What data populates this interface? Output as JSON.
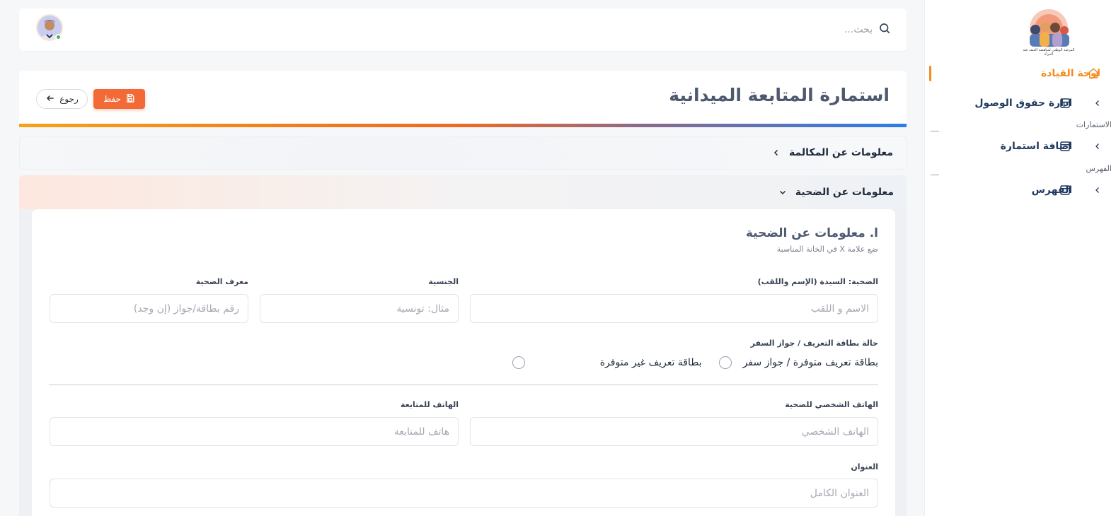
{
  "sidebar": {
    "logo_text": "المرصد الوطني لمناهضة العنف ضد المرأة",
    "items": [
      {
        "label": "لوحة القيادة",
        "icon": "home-icon"
      },
      {
        "label": "ادارة حقوق الوصول",
        "icon": "layout-icon"
      },
      {
        "label": "اضافة استمارة",
        "icon": "form-icon"
      },
      {
        "label": "الفهرس",
        "icon": "form-icon"
      }
    ],
    "sections": [
      "الاستمارات",
      "الفهرس"
    ]
  },
  "topbar": {
    "search_placeholder": "بحث..."
  },
  "header": {
    "title": "استمارة المتابعة الميدانية",
    "save_label": "حفظ",
    "back_label": "رجوع"
  },
  "accordions": [
    {
      "title": "معلومات عن المكالمة",
      "expanded": false
    },
    {
      "title": "معلومات عن الضحية",
      "expanded": true
    }
  ],
  "form": {
    "section_title": "ا. معلومات عن الضحية",
    "section_subtitle": "ضع علامة X في الخانة المناسبة",
    "fields": {
      "victim_name": {
        "label": "الضحية: السيدة (الإسم واللقب)",
        "placeholder": "الاسم و اللقب"
      },
      "nationality": {
        "label": "الجنسية",
        "placeholder": "مثال: تونسية"
      },
      "victim_id": {
        "label": "معرف الضحية",
        "placeholder": "رقم بطاقة/جواز (إن وجد)"
      },
      "id_status": {
        "label": "حالة بطاقة التعريف / جواز السفر",
        "options": [
          "بطاقة تعريف متوفرة / جواز سفر",
          "بطاقة تعريف غير متوفرة"
        ]
      },
      "personal_phone": {
        "label": "الهاتف الشخصي للضحية",
        "placeholder": "الهاتف الشخصي"
      },
      "followup_phone": {
        "label": "الهاتف للمتابعة",
        "placeholder": "هاتف للمتابعة"
      },
      "address": {
        "label": "العنوان",
        "placeholder": "العنوان الكامل"
      }
    }
  },
  "colors": {
    "accent": "#f58a1f",
    "save_button": "#f26a35",
    "nav_text": "#1f3a5f"
  }
}
